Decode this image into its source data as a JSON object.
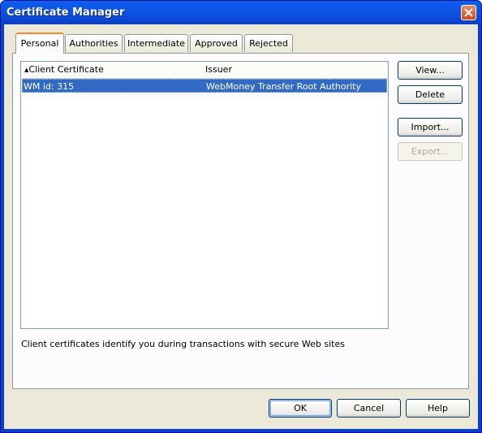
{
  "window": {
    "title": "Certificate Manager"
  },
  "tabs": [
    {
      "label": "Personal",
      "active": true
    },
    {
      "label": "Authorities"
    },
    {
      "label": "Intermediate"
    },
    {
      "label": "Approved"
    },
    {
      "label": "Rejected"
    }
  ],
  "table": {
    "columns": [
      "Client Certificate",
      "Issuer"
    ],
    "sort_indicator": "▲",
    "rows": [
      {
        "certificate": "WM id: 315",
        "issuer": "WebMoney Transfer Root Authority",
        "selected": true
      }
    ]
  },
  "side_buttons": {
    "view": "View...",
    "delete": "Delete",
    "import": "Import...",
    "export": "Export..."
  },
  "description": "Client certificates identify you during transactions with secure Web sites",
  "footer": {
    "ok": "OK",
    "cancel": "Cancel",
    "help": "Help"
  }
}
